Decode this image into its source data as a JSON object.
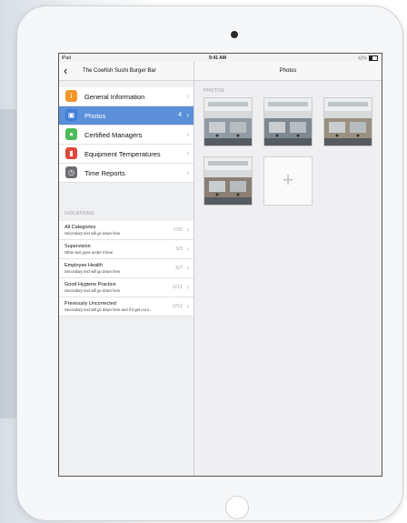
{
  "status_bar": {
    "device": "iPad",
    "time": "9:41 AM",
    "battery": "42%"
  },
  "left_nav": {
    "back_glyph": "‹",
    "title": "The Cowfish Sushi Burger Bar"
  },
  "right_nav": {
    "title": "Photos"
  },
  "menu": [
    {
      "label": "General Information",
      "icon": "info-icon",
      "color": "#f2962a",
      "glyph": "i",
      "count": ""
    },
    {
      "label": "Photos",
      "icon": "photo-icon",
      "color": "#3f7ed8",
      "glyph": "▣",
      "count": "4",
      "selected": true
    },
    {
      "label": "Certified Managers",
      "icon": "person-icon",
      "color": "#4cbb56",
      "glyph": "●",
      "count": ""
    },
    {
      "label": "Equipment Temperatures",
      "icon": "thermometer-icon",
      "color": "#e0473c",
      "glyph": "▮",
      "count": ""
    },
    {
      "label": "Time Reports",
      "icon": "clock-icon",
      "color": "#6e6e72",
      "glyph": "◷",
      "count": ""
    }
  ],
  "violations_header": "VIOLATIONS",
  "violations": [
    {
      "title": "All Categories",
      "subtitle": "Secondary text will go down here",
      "count": "7/20"
    },
    {
      "title": "Supervision",
      "subtitle": "Other text goes under it here",
      "count": "3/3"
    },
    {
      "title": "Employee Health",
      "subtitle": "Secondary text will go down here",
      "count": "5/7"
    },
    {
      "title": "Good Hygiene Practice",
      "subtitle": "Secondary text will go down here",
      "count": "0/12"
    },
    {
      "title": "Previously Uncorrected",
      "subtitle": "Secondary text will go down here and if it get cut s...",
      "count": "0/12"
    }
  ],
  "photos_header": "PHOTOS",
  "photos": [
    {
      "name": "kitchen-photo-1",
      "color": "#8f9aa3"
    },
    {
      "name": "kitchen-photo-2",
      "color": "#7e8890"
    },
    {
      "name": "kitchen-photo-3",
      "color": "#9a9080"
    },
    {
      "name": "kitchen-photo-4",
      "color": "#8a7f74"
    }
  ],
  "add_photo_glyph": "+"
}
